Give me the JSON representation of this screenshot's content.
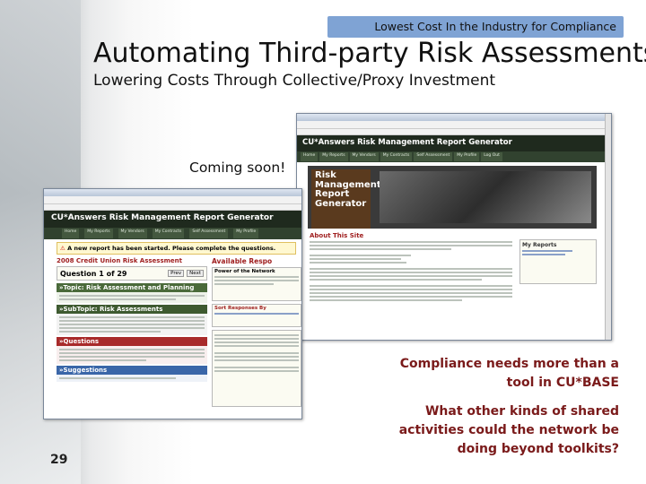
{
  "banner": {
    "text": "Lowest Cost In the Industry for Compliance"
  },
  "title": "Automating Third-party Risk Assessments",
  "subtitle": "Lowering Costs Through Collective/Proxy Investment",
  "coming_soon": "Coming soon!",
  "notes": {
    "compliance_1": "Compliance needs more than a",
    "compliance_2": "tool in CU*BASE",
    "question_1": "What other kinds of shared",
    "question_2": "activities could the network be",
    "question_3": "doing beyond toolkits?"
  },
  "page_number": "29",
  "screenshot_right": {
    "header": "CU*Answers Risk Management Report Generator",
    "nav": [
      "Home",
      "My Reports",
      "My Vendors",
      "My Contracts",
      "Self Assessment",
      "My Profile",
      "Log Out"
    ],
    "logo_lines": [
      "Risk",
      "Management",
      "Report",
      "Generator"
    ],
    "about_heading": "About This Site",
    "sidebar_heading": "My Reports"
  },
  "screenshot_left": {
    "header": "CU*Answers Risk Management Report Generator",
    "nav": [
      "Home",
      "My Reports",
      "My Vendors",
      "My Contracts",
      "Self Assessment",
      "My Profile"
    ],
    "alert": "A new report has been started. Please complete the questions.",
    "report_heading": "2008 Credit Union Risk Assessment",
    "question_counter": "Question 1 of 29",
    "topic_1": "»Topic: Risk Assessment and Planning",
    "subtopic": "»SubTopic: Risk Assessments",
    "questions_heading": "»Questions",
    "suggestions_heading": "»Suggestions",
    "available_heading": "Available Respo",
    "power_heading": "Power of the Network",
    "sort_heading": "Sort Responses By",
    "prev_label": "Prev",
    "next_label": "Next"
  }
}
